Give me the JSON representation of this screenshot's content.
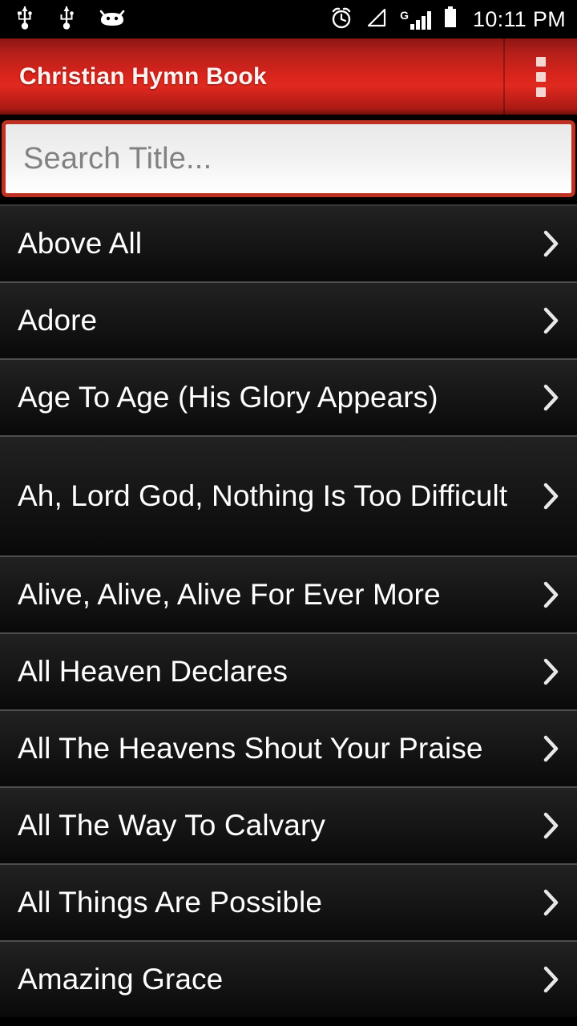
{
  "status_bar": {
    "left_icons": [
      "usb-icon",
      "usb-icon",
      "android-head-icon"
    ],
    "right_icons": [
      "alarm-clock-icon",
      "no-signal-triangle-icon",
      "cell-signal-bars-icon",
      "battery-full-icon"
    ],
    "network_type": "G",
    "time": "10:11 PM"
  },
  "action_bar": {
    "title": "Christian Hymn Book",
    "overflow_icon": "overflow-menu-icon",
    "accent_color": "#d8241c"
  },
  "search": {
    "value": "",
    "placeholder": "Search Title...",
    "border_color": "#bf3223"
  },
  "list": {
    "disclosure_icon": "chevron-right-icon",
    "items": [
      {
        "title": "Above All"
      },
      {
        "title": "Adore"
      },
      {
        "title": "Age To Age (His Glory Appears)"
      },
      {
        "title": "Ah, Lord God, Nothing Is Too Difficult"
      },
      {
        "title": "Alive, Alive, Alive For Ever More"
      },
      {
        "title": "All Heaven Declares"
      },
      {
        "title": "All The Heavens Shout Your Praise"
      },
      {
        "title": "All The Way To Calvary"
      },
      {
        "title": "All Things Are Possible"
      },
      {
        "title": "Amazing Grace"
      }
    ]
  }
}
